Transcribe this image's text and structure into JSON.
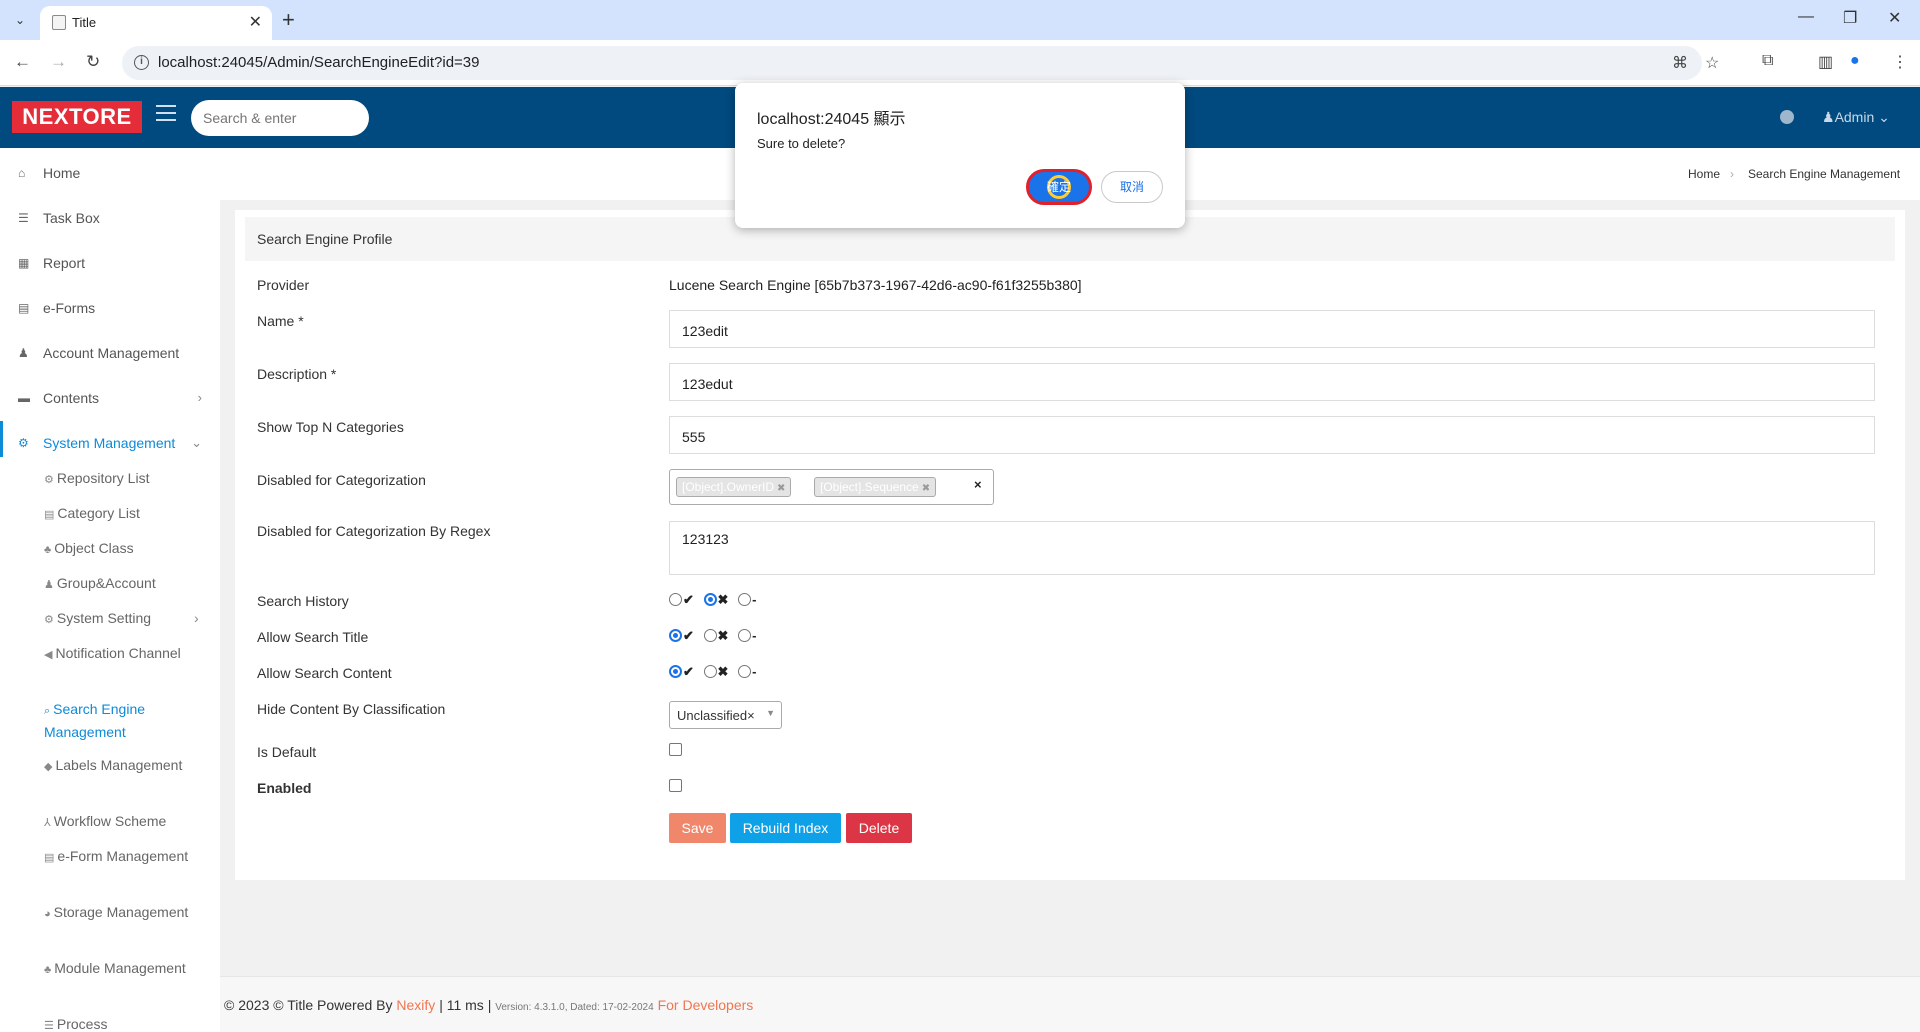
{
  "browser": {
    "tab_title": "Title",
    "url": "localhost:24045/Admin/SearchEngineEdit?id=39"
  },
  "header": {
    "logo": "NEXTORE",
    "search_placeholder": "Search & enter",
    "user": "Admin"
  },
  "sidebar": {
    "items": [
      {
        "label": "Home",
        "icon": "home-icon"
      },
      {
        "label": "Task Box",
        "icon": "tasks-icon"
      },
      {
        "label": "Report",
        "icon": "table-icon"
      },
      {
        "label": "e-Forms",
        "icon": "form-icon"
      },
      {
        "label": "Account Management",
        "icon": "user-icon"
      },
      {
        "label": "Contents",
        "icon": "folder-icon"
      },
      {
        "label": "System Management",
        "icon": "cogs-icon"
      }
    ],
    "subitems": [
      {
        "label": "Repository List",
        "icon": "cogs-icon"
      },
      {
        "label": "Category List",
        "icon": "list-icon"
      },
      {
        "label": "Object Class",
        "icon": "sitemap-icon"
      },
      {
        "label": "Group&Account",
        "icon": "user-icon"
      },
      {
        "label": "System Setting",
        "icon": "cogs-icon"
      },
      {
        "label": "Notification Channel",
        "icon": "bullhorn-icon"
      },
      {
        "label": "Search Engine Management",
        "icon": "search-icon"
      },
      {
        "label": "Labels Management",
        "icon": "tags-icon"
      },
      {
        "label": "Workflow Scheme",
        "icon": "flow-icon"
      },
      {
        "label": "e-Form Management",
        "icon": "form-icon"
      },
      {
        "label": "Storage Management",
        "icon": "pie-icon"
      },
      {
        "label": "Module Management",
        "icon": "sitemap-icon"
      },
      {
        "label": "Process",
        "icon": "list-icon"
      }
    ]
  },
  "breadcrumb": {
    "home": "Home",
    "current": "Search Engine Management"
  },
  "form": {
    "section_title": "Search Engine Profile",
    "provider_label": "Provider",
    "provider_value": "Lucene Search Engine [65b7b373-1967-42d6-ac90-f61f3255b380]",
    "name_label": "Name *",
    "name_value": "123edit",
    "description_label": "Description *",
    "description_value": "123edut",
    "topn_label": "Show Top N Categories",
    "topn_value": "555",
    "disabled_cat_label": "Disabled for Categorization",
    "disabled_cat_tags": [
      "[Object].OwnerID",
      "[Object].Sequence"
    ],
    "disabled_regex_label": "Disabled for Categorization By Regex",
    "disabled_regex_value": "123123",
    "search_history_label": "Search History",
    "search_history_selected": "no",
    "allow_title_label": "Allow Search Title",
    "allow_title_selected": "yes",
    "allow_content_label": "Allow Search Content",
    "allow_content_selected": "yes",
    "radio_yes": "✔",
    "radio_no": "✖",
    "radio_none": "-",
    "hide_content_label": "Hide Content By Classification",
    "hide_content_value": "Unclassified",
    "is_default_label": "Is Default",
    "is_default_checked": false,
    "enabled_label": "Enabled",
    "enabled_checked": false,
    "save_label": "Save",
    "rebuild_label": "Rebuild Index",
    "delete_label": "Delete"
  },
  "footer": {
    "copyright": "© 2023 © Title Powered By",
    "brand": "Nexify",
    "timing": "| 11 ms |",
    "version": "Version: 4.3.1.0, Dated: 17-02-2024",
    "developers": "For Developers"
  },
  "dialog": {
    "host": "localhost:24045 顯示",
    "message": "Sure to delete?",
    "ok_label": "確定",
    "cancel_label": "取消"
  },
  "colors": {
    "header_bg": "#004a7f",
    "logo_bg": "#e52d3a",
    "accent": "#0d8ad8",
    "save": "#f0876a",
    "rebuild": "#0ea1e8",
    "delete": "#dc3545"
  }
}
